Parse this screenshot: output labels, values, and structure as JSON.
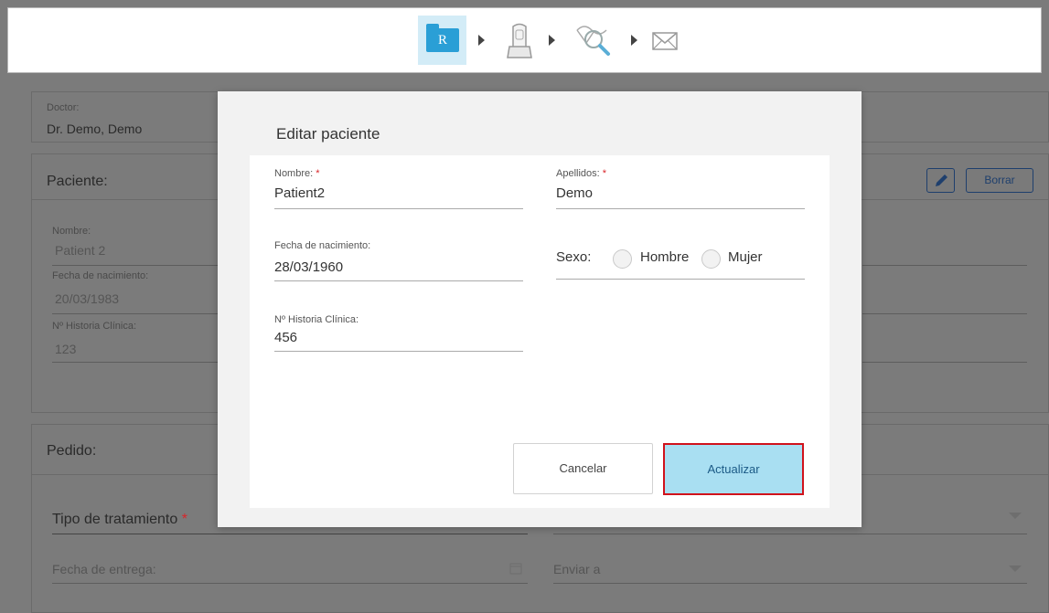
{
  "toolbar": {
    "steps": [
      {
        "name": "Rx",
        "icon": "rx-folder-icon",
        "label": "R"
      },
      {
        "name": "Scan",
        "icon": "scan-icon"
      },
      {
        "name": "View",
        "icon": "view-icon"
      },
      {
        "name": "Send",
        "icon": "send-icon"
      }
    ]
  },
  "background": {
    "doctor_label": "Doctor:",
    "doctor_value": "Dr. Demo, Demo",
    "patient_title": "Paciente:",
    "patient_delete": "Borrar",
    "patient_fields": [
      {
        "label": "Nombre:",
        "value": "Patient 2"
      },
      {
        "label": "Fecha de nacimiento:",
        "value": "20/03/1983"
      },
      {
        "label": "Nº Historia Clínica:",
        "value": "123"
      }
    ],
    "order_title": "Pedido:",
    "treatment_label": "Tipo de tratamiento",
    "treatment_req": "*",
    "delivery_label": "Fecha de entrega:",
    "send_to_label": "Enviar a"
  },
  "modal": {
    "title": "Editar paciente",
    "first_name": {
      "label": "Nombre:",
      "req": "*",
      "value": "Patient2"
    },
    "last_name": {
      "label": "Apellidos:",
      "req": "*",
      "value": "Demo"
    },
    "dob": {
      "label": "Fecha de nacimiento:",
      "value": "28/03/1960"
    },
    "sex": {
      "label": "Sexo:",
      "options": [
        "Hombre",
        "Mujer"
      ]
    },
    "chart_no": {
      "label": "Nº Historia Clínica:",
      "value": "456"
    },
    "cancel_label": "Cancelar",
    "update_label": "Actualizar"
  }
}
